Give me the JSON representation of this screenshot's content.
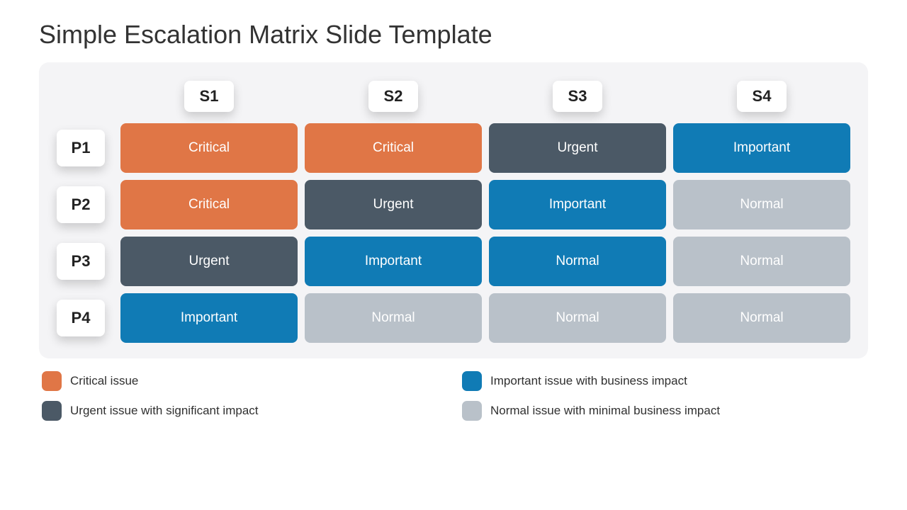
{
  "title": "Simple Escalation Matrix Slide Template",
  "columns": [
    "S1",
    "S2",
    "S3",
    "S4"
  ],
  "rows": [
    "P1",
    "P2",
    "P3",
    "P4"
  ],
  "cells": [
    [
      {
        "label": "Critical",
        "color": "#e07646"
      },
      {
        "label": "Critical",
        "color": "#e07646"
      },
      {
        "label": "Urgent",
        "color": "#4b5966"
      },
      {
        "label": "Important",
        "color": "#107bb5"
      }
    ],
    [
      {
        "label": "Critical",
        "color": "#e07646"
      },
      {
        "label": "Urgent",
        "color": "#4b5966"
      },
      {
        "label": "Important",
        "color": "#107bb5"
      },
      {
        "label": "Normal",
        "color": "#b9c1c9"
      }
    ],
    [
      {
        "label": "Urgent",
        "color": "#4b5966"
      },
      {
        "label": "Important",
        "color": "#107bb5"
      },
      {
        "label": "Normal",
        "color": "#107bb5"
      },
      {
        "label": "Normal",
        "color": "#b9c1c9"
      }
    ],
    [
      {
        "label": "Important",
        "color": "#107bb5"
      },
      {
        "label": "Normal",
        "color": "#b9c1c9"
      },
      {
        "label": "Normal",
        "color": "#b9c1c9"
      },
      {
        "label": "Normal",
        "color": "#b9c1c9"
      }
    ]
  ],
  "legend": [
    {
      "color": "#e07646",
      "label": "Critical issue"
    },
    {
      "color": "#107bb5",
      "label": "Important issue with business impact"
    },
    {
      "color": "#4b5966",
      "label": "Urgent issue with significant impact"
    },
    {
      "color": "#b9c1c9",
      "label": "Normal issue with minimal business impact"
    }
  ]
}
